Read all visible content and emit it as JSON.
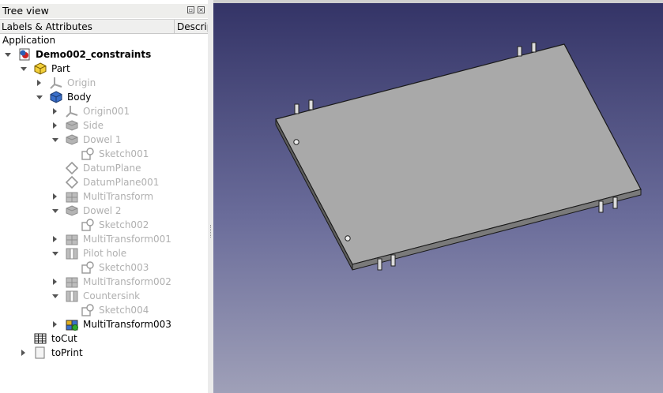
{
  "panel": {
    "title": "Tree view"
  },
  "columns": {
    "labels": "Labels & Attributes",
    "description": "Description"
  },
  "root": "Application",
  "tree": [
    {
      "label": "Demo002_constraints",
      "icon": "document-icon",
      "expander": "down",
      "state": "bold"
    },
    {
      "label": "Part",
      "icon": "part-icon",
      "expander": "down",
      "state": "normal"
    },
    {
      "label": "Origin",
      "icon": "origin-axes-icon",
      "expander": "right",
      "state": "hidden"
    },
    {
      "label": "Body",
      "icon": "body-icon",
      "expander": "down",
      "state": "normal"
    },
    {
      "label": "Origin001",
      "icon": "origin-axes-icon",
      "expander": "right",
      "state": "hidden"
    },
    {
      "label": "Side",
      "icon": "pad-icon",
      "expander": "right",
      "state": "hidden"
    },
    {
      "label": "Dowel 1",
      "icon": "pad-icon",
      "expander": "down",
      "state": "hidden"
    },
    {
      "label": "Sketch001",
      "icon": "sketch-icon",
      "expander": "none",
      "state": "hidden"
    },
    {
      "label": "DatumPlane",
      "icon": "datum-plane-icon",
      "expander": "none",
      "state": "hidden"
    },
    {
      "label": "DatumPlane001",
      "icon": "datum-plane-icon",
      "expander": "none",
      "state": "hidden"
    },
    {
      "label": "MultiTransform",
      "icon": "multitransform-icon",
      "expander": "right",
      "state": "hidden"
    },
    {
      "label": "Dowel 2",
      "icon": "pad-icon",
      "expander": "down",
      "state": "hidden"
    },
    {
      "label": "Sketch002",
      "icon": "sketch-icon",
      "expander": "none",
      "state": "hidden"
    },
    {
      "label": "MultiTransform001",
      "icon": "multitransform-icon",
      "expander": "right",
      "state": "hidden"
    },
    {
      "label": "Pilot hole",
      "icon": "hole-icon",
      "expander": "down",
      "state": "hidden"
    },
    {
      "label": "Sketch003",
      "icon": "sketch-icon",
      "expander": "none",
      "state": "hidden"
    },
    {
      "label": "MultiTransform002",
      "icon": "multitransform-icon",
      "expander": "right",
      "state": "hidden"
    },
    {
      "label": "Countersink",
      "icon": "hole-icon",
      "expander": "down",
      "state": "hidden"
    },
    {
      "label": "Sketch004",
      "icon": "sketch-icon",
      "expander": "none",
      "state": "hidden"
    },
    {
      "label": "MultiTransform003",
      "icon": "multitransform-tip-icon",
      "expander": "right",
      "state": "normal"
    },
    {
      "label": "toCut",
      "icon": "spreadsheet-icon",
      "expander": "none",
      "state": "normal"
    },
    {
      "label": "toPrint",
      "icon": "page-icon",
      "expander": "right",
      "state": "normal"
    }
  ],
  "colors": {
    "viewport_top": "#333366",
    "viewport_bottom": "#9fa0b8",
    "part_face": "#a9a9a9"
  }
}
